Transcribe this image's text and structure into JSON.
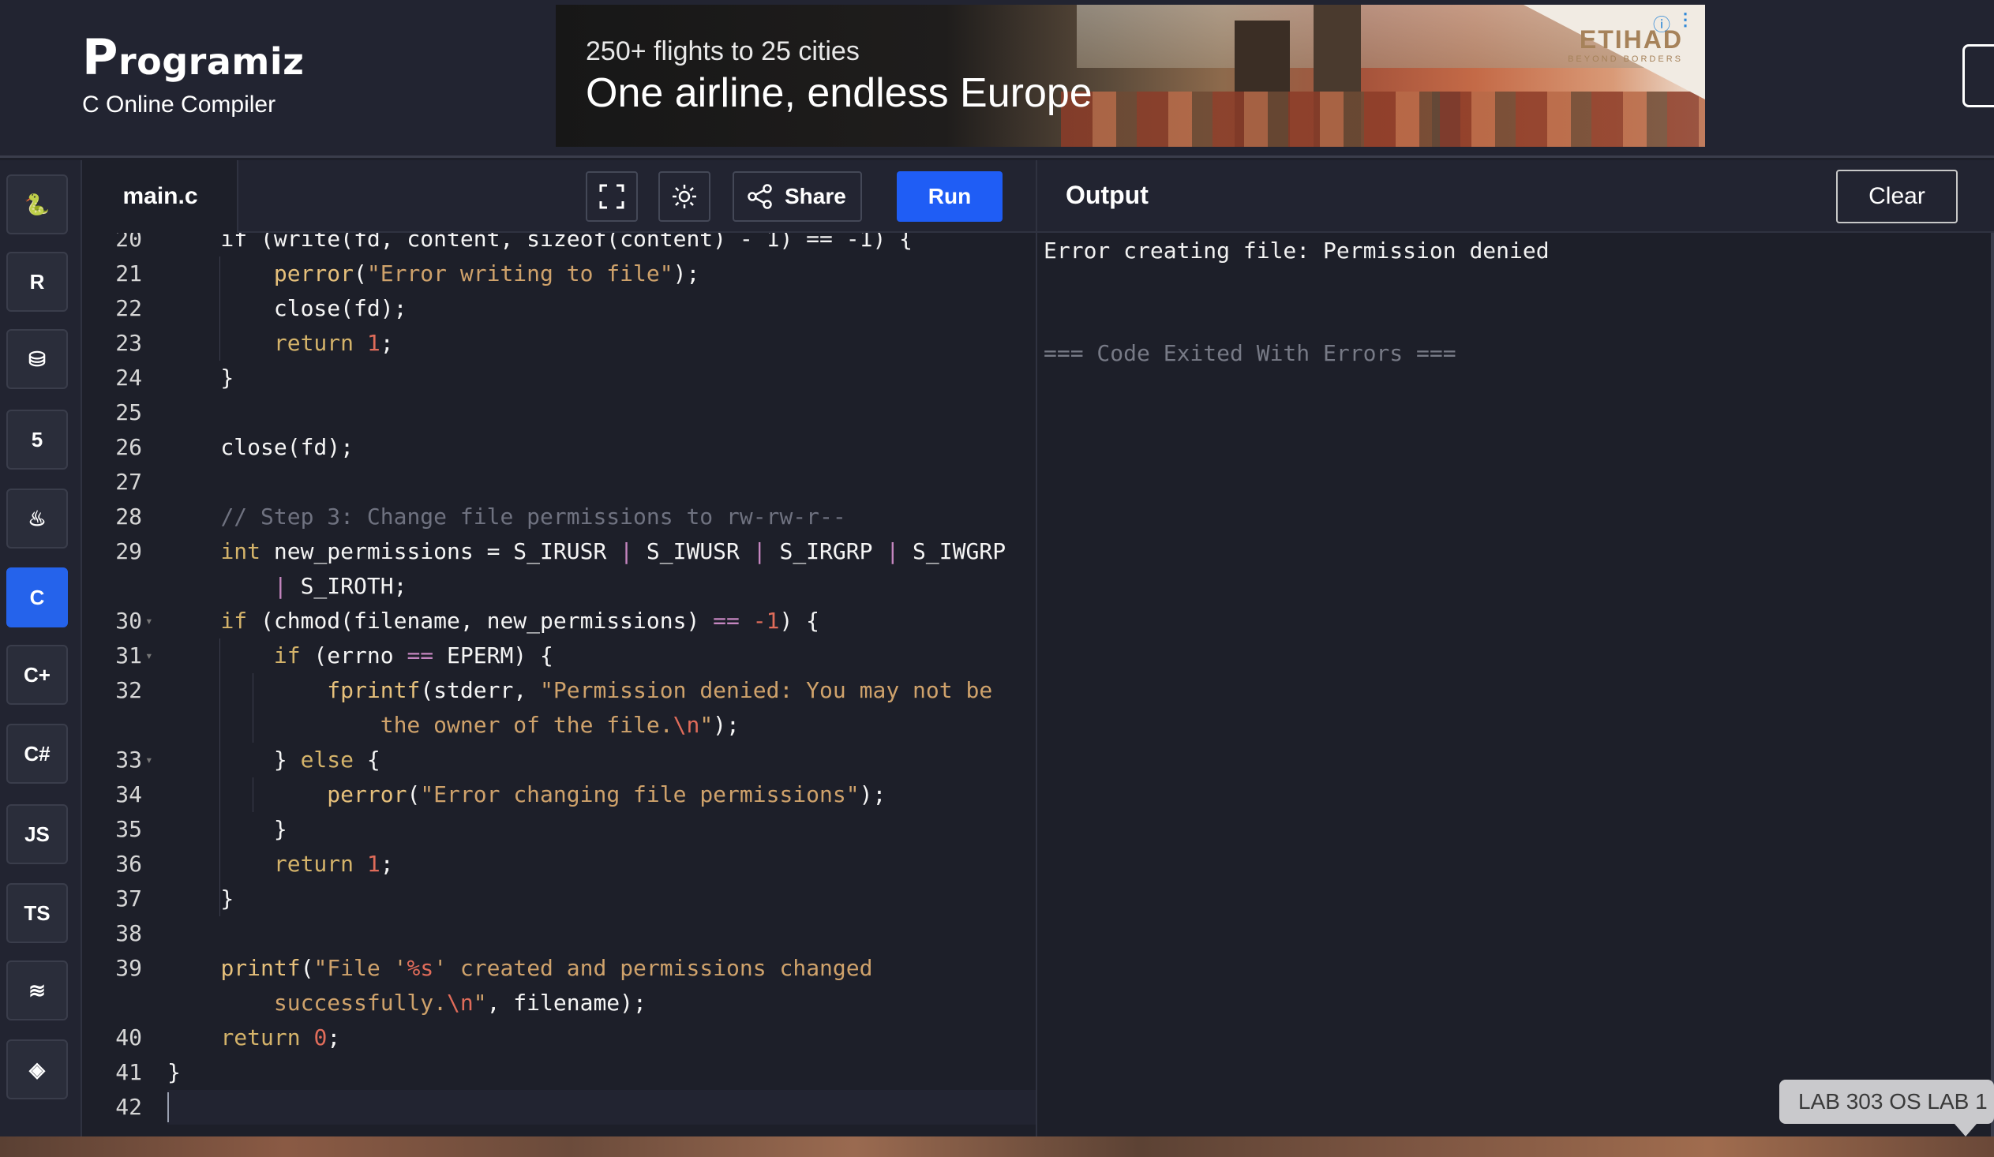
{
  "header": {
    "logo_initial": "P",
    "logo_rest": "rogramiz",
    "subtitle": "C Online Compiler"
  },
  "ad": {
    "line1": "250+ flights to 25 cities",
    "line2": "One airline, endless Europe",
    "brand": "ETIHAD",
    "brand_tagline": "BEYOND BORDERS",
    "info_icon": "ⓘ",
    "more_icon": "⋮"
  },
  "sidebar": {
    "languages": [
      {
        "name": "python-icon",
        "glyph": "🐍"
      },
      {
        "name": "r-icon",
        "glyph": "R"
      },
      {
        "name": "sql-icon",
        "glyph": "⛁"
      },
      {
        "name": "html5-icon",
        "glyph": "5"
      },
      {
        "name": "java-icon",
        "glyph": "♨"
      },
      {
        "name": "c-icon",
        "glyph": "C",
        "active": true
      },
      {
        "name": "cpp-icon",
        "glyph": "C+"
      },
      {
        "name": "csharp-icon",
        "glyph": "C#"
      },
      {
        "name": "js-icon",
        "glyph": "JS"
      },
      {
        "name": "ts-icon",
        "glyph": "TS"
      },
      {
        "name": "swift-icon",
        "glyph": "≋"
      },
      {
        "name": "go-icon",
        "glyph": "◈"
      }
    ]
  },
  "editor": {
    "file_name": "main.c",
    "share_label": "Share",
    "run_label": "Run",
    "fullscreen_icon": "⛶",
    "theme_icon": "☼",
    "share_icon": "⋖"
  },
  "output": {
    "title": "Output",
    "clear_label": "Clear",
    "error_line": "Error creating file: Permission denied",
    "exit_line": "=== Code Exited With Errors ==="
  },
  "tooltip": {
    "text": "LAB 303 OS LAB 1"
  },
  "code": {
    "lines": [
      {
        "num": "20",
        "fold": false,
        "tokens": [
          [
            "",
            "    if (write(fd, content, sizeof(content) - 1) == -1) {"
          ]
        ]
      },
      {
        "num": "21",
        "fold": false,
        "tokens": [
          [
            "",
            "        "
          ],
          [
            "fn",
            "perror"
          ],
          [
            "",
            "("
          ],
          [
            "str",
            "\"Error writing to file\""
          ],
          [
            "",
            ");"
          ]
        ]
      },
      {
        "num": "22",
        "fold": false,
        "tokens": [
          [
            "",
            "        close(fd);"
          ]
        ]
      },
      {
        "num": "23",
        "fold": false,
        "tokens": [
          [
            "",
            "        "
          ],
          [
            "kw",
            "return"
          ],
          [
            "",
            " "
          ],
          [
            "num",
            "1"
          ],
          [
            "",
            ";"
          ]
        ]
      },
      {
        "num": "24",
        "fold": false,
        "tokens": [
          [
            "",
            "    }"
          ]
        ]
      },
      {
        "num": "25",
        "fold": false,
        "tokens": [
          [
            "",
            ""
          ]
        ]
      },
      {
        "num": "26",
        "fold": false,
        "tokens": [
          [
            "",
            "    close(fd);"
          ]
        ]
      },
      {
        "num": "27",
        "fold": false,
        "tokens": [
          [
            "",
            ""
          ]
        ]
      },
      {
        "num": "28",
        "fold": false,
        "tokens": [
          [
            "",
            "    "
          ],
          [
            "com",
            "// Step 3: Change file permissions to rw-rw-r--"
          ]
        ]
      },
      {
        "num": "29",
        "fold": false,
        "tokens": [
          [
            "",
            "    "
          ],
          [
            "kw",
            "int"
          ],
          [
            "",
            " new_permissions = S_IRUSR "
          ],
          [
            "op",
            "|"
          ],
          [
            "",
            " S_IWUSR "
          ],
          [
            "op",
            "|"
          ],
          [
            "",
            " S_IRGRP "
          ],
          [
            "op",
            "|"
          ],
          [
            "",
            " S_IWGRP"
          ]
        ]
      },
      {
        "num": "",
        "fold": false,
        "tokens": [
          [
            "",
            "        "
          ],
          [
            "op",
            "|"
          ],
          [
            "",
            " S_IROTH;"
          ]
        ]
      },
      {
        "num": "30",
        "fold": true,
        "tokens": [
          [
            "",
            "    "
          ],
          [
            "kw",
            "if"
          ],
          [
            "",
            " (chmod(filename, new_permissions) "
          ],
          [
            "op",
            "=="
          ],
          [
            "",
            " "
          ],
          [
            "num",
            "-1"
          ],
          [
            "",
            ") {"
          ]
        ]
      },
      {
        "num": "31",
        "fold": true,
        "tokens": [
          [
            "",
            "        "
          ],
          [
            "kw",
            "if"
          ],
          [
            "",
            " (errno "
          ],
          [
            "op",
            "=="
          ],
          [
            "",
            " EPERM) {"
          ]
        ]
      },
      {
        "num": "32",
        "fold": false,
        "tokens": [
          [
            "",
            "            "
          ],
          [
            "fn",
            "fprintf"
          ],
          [
            "",
            "(stderr, "
          ],
          [
            "str",
            "\"Permission denied: You may not be"
          ]
        ]
      },
      {
        "num": "",
        "fold": false,
        "tokens": [
          [
            "str",
            "                the owner of the file."
          ],
          [
            "esc",
            "\\n"
          ],
          [
            "str",
            "\""
          ],
          [
            "",
            ");"
          ]
        ]
      },
      {
        "num": "33",
        "fold": true,
        "tokens": [
          [
            "",
            "        } "
          ],
          [
            "kw",
            "else"
          ],
          [
            "",
            " {"
          ]
        ]
      },
      {
        "num": "34",
        "fold": false,
        "tokens": [
          [
            "",
            "            "
          ],
          [
            "fn",
            "perror"
          ],
          [
            "",
            "("
          ],
          [
            "str",
            "\"Error changing file permissions\""
          ],
          [
            "",
            ");"
          ]
        ]
      },
      {
        "num": "35",
        "fold": false,
        "tokens": [
          [
            "",
            "        }"
          ]
        ]
      },
      {
        "num": "36",
        "fold": false,
        "tokens": [
          [
            "",
            "        "
          ],
          [
            "kw",
            "return"
          ],
          [
            "",
            " "
          ],
          [
            "num",
            "1"
          ],
          [
            "",
            ";"
          ]
        ]
      },
      {
        "num": "37",
        "fold": false,
        "tokens": [
          [
            "",
            "    }"
          ]
        ]
      },
      {
        "num": "38",
        "fold": false,
        "tokens": [
          [
            "",
            ""
          ]
        ]
      },
      {
        "num": "39",
        "fold": false,
        "tokens": [
          [
            "",
            "    "
          ],
          [
            "fn",
            "printf"
          ],
          [
            "",
            "("
          ],
          [
            "str",
            "\"File '"
          ],
          [
            "esc",
            "%s"
          ],
          [
            "str",
            "' created and permissions changed"
          ]
        ]
      },
      {
        "num": "",
        "fold": false,
        "tokens": [
          [
            "str",
            "        successfully."
          ],
          [
            "esc",
            "\\n"
          ],
          [
            "str",
            "\""
          ],
          [
            "",
            ", filename);"
          ]
        ]
      },
      {
        "num": "40",
        "fold": false,
        "tokens": [
          [
            "",
            "    "
          ],
          [
            "kw",
            "return"
          ],
          [
            "",
            " "
          ],
          [
            "num",
            "0"
          ],
          [
            "",
            ";"
          ]
        ]
      },
      {
        "num": "41",
        "fold": false,
        "tokens": [
          [
            "",
            "}"
          ]
        ]
      },
      {
        "num": "42",
        "fold": false,
        "tokens": [
          [
            "",
            ""
          ]
        ],
        "current": true
      }
    ]
  }
}
